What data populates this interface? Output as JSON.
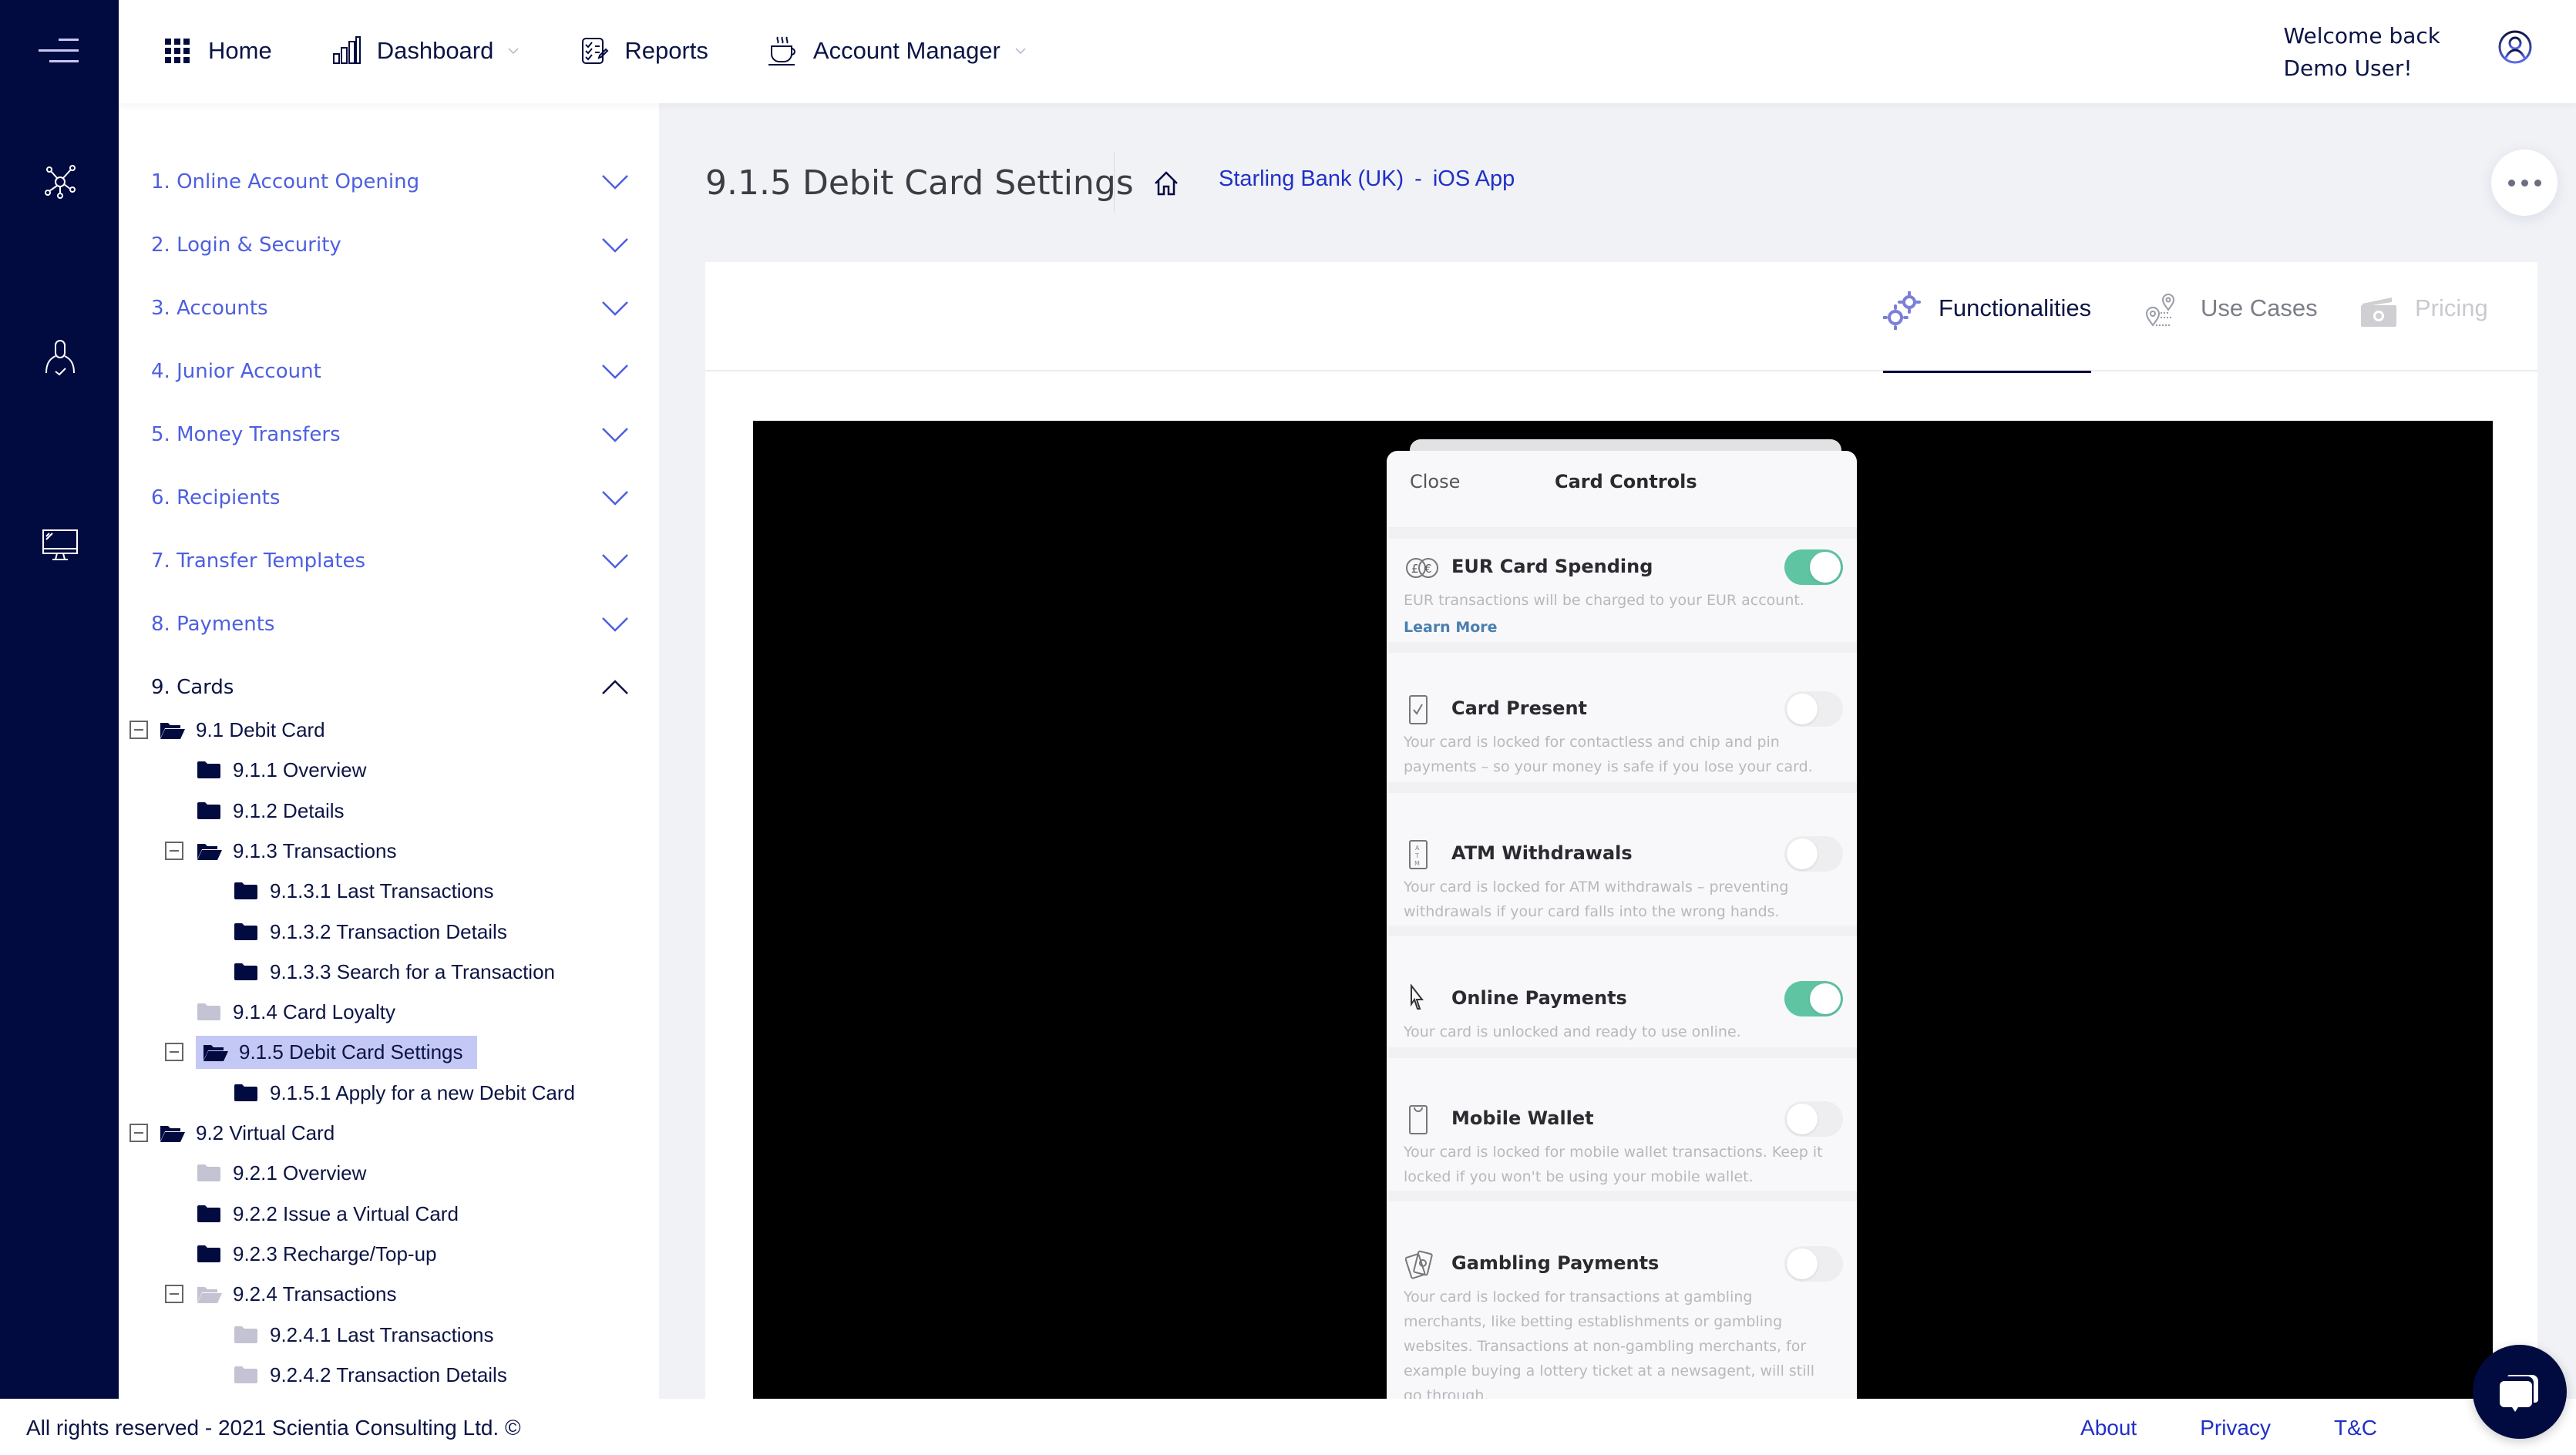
{
  "header": {
    "nav": [
      {
        "label": "Home",
        "icon": "grid-icon",
        "has_dropdown": false
      },
      {
        "label": "Dashboard",
        "icon": "bar-chart-icon",
        "has_dropdown": true
      },
      {
        "label": "Reports",
        "icon": "report-checklist-icon",
        "has_dropdown": false
      },
      {
        "label": "Account Manager",
        "icon": "coffee-cup-icon",
        "has_dropdown": true
      }
    ],
    "welcome_line1": "Welcome back",
    "welcome_line2": "Demo User!",
    "avatar_icon": "user-circle-icon"
  },
  "rail": {
    "icons": [
      "menu-icon",
      "network-icon",
      "user-check-icon",
      "monitor-icon"
    ]
  },
  "sidebar": {
    "sections": [
      {
        "label": "1. Online Account Opening",
        "expanded": false
      },
      {
        "label": "2. Login & Security",
        "expanded": false
      },
      {
        "label": "3. Accounts",
        "expanded": false
      },
      {
        "label": "4. Junior Account",
        "expanded": false
      },
      {
        "label": "5. Money Transfers",
        "expanded": false
      },
      {
        "label": "6. Recipients",
        "expanded": false
      },
      {
        "label": "7. Transfer Templates",
        "expanded": false
      },
      {
        "label": "8. Payments",
        "expanded": false
      },
      {
        "label": "9. Cards",
        "expanded": true
      }
    ],
    "tree": [
      {
        "label": "9.1 Debit Card",
        "level": 0,
        "folder": "open",
        "state": "active",
        "toggle": true
      },
      {
        "label": "9.1.1 Overview",
        "level": 1,
        "folder": "closed",
        "state": "active",
        "toggle": false
      },
      {
        "label": "9.1.2 Details",
        "level": 1,
        "folder": "closed",
        "state": "active",
        "toggle": false
      },
      {
        "label": "9.1.3 Transactions",
        "level": 1,
        "folder": "open",
        "state": "active",
        "toggle": true
      },
      {
        "label": "9.1.3.1 Last Transactions",
        "level": 2,
        "folder": "closed",
        "state": "active",
        "toggle": false
      },
      {
        "label": "9.1.3.2 Transaction Details",
        "level": 2,
        "folder": "closed",
        "state": "active",
        "toggle": false
      },
      {
        "label": "9.1.3.3 Search for a Transaction",
        "level": 2,
        "folder": "closed",
        "state": "active",
        "toggle": false
      },
      {
        "label": "9.1.4 Card Loyalty",
        "level": 1,
        "folder": "closed",
        "state": "inactive",
        "toggle": false
      },
      {
        "label": "9.1.5 Debit Card Settings",
        "level": 1,
        "folder": "open",
        "state": "active",
        "toggle": true,
        "selected": true
      },
      {
        "label": "9.1.5.1 Apply for a new Debit Card",
        "level": 2,
        "folder": "closed",
        "state": "active",
        "toggle": false
      },
      {
        "label": "9.2 Virtual Card",
        "level": 0,
        "folder": "open",
        "state": "active",
        "toggle": true
      },
      {
        "label": "9.2.1 Overview",
        "level": 1,
        "folder": "closed",
        "state": "inactive",
        "toggle": false
      },
      {
        "label": "9.2.2 Issue a Virtual Card",
        "level": 1,
        "folder": "closed",
        "state": "active",
        "toggle": false
      },
      {
        "label": "9.2.3 Recharge/Top-up",
        "level": 1,
        "folder": "closed",
        "state": "active",
        "toggle": false
      },
      {
        "label": "9.2.4 Transactions",
        "level": 1,
        "folder": "open",
        "state": "inactive",
        "toggle": true
      },
      {
        "label": "9.2.4.1 Last Transactions",
        "level": 2,
        "folder": "closed",
        "state": "inactive",
        "toggle": false
      },
      {
        "label": "9.2.4.2 Transaction Details",
        "level": 2,
        "folder": "closed",
        "state": "inactive",
        "toggle": false
      }
    ]
  },
  "main": {
    "page_title": "9.1.5 Debit Card Settings",
    "breadcrumb": {
      "bank": "Starling Bank (UK)",
      "separator": "-",
      "platform": "iOS App"
    },
    "tabs": [
      {
        "label": "Functionalities",
        "icon": "gears-icon",
        "active": true
      },
      {
        "label": "Use Cases",
        "icon": "route-pins-icon",
        "active": false
      },
      {
        "label": "Pricing",
        "icon": "banknote-icon",
        "active": false,
        "disabled": true
      }
    ]
  },
  "phone": {
    "close_label": "Close",
    "title": "Card Controls",
    "controls": [
      {
        "title": "EUR Card Spending",
        "icon": "currency-gbp-eur-icon",
        "on": true,
        "desc": "EUR transactions will be charged to your EUR account.",
        "link": "Learn More"
      },
      {
        "title": "Card Present",
        "icon": "card-check-icon",
        "on": false,
        "desc": "Your card is locked for contactless and chip and pin payments – so your money is safe if you lose your card."
      },
      {
        "title": "ATM Withdrawals",
        "icon": "atm-icon",
        "on": false,
        "desc": "Your card is locked for ATM withdrawals – preventing withdrawals if your card falls into the wrong hands."
      },
      {
        "title": "Online Payments",
        "icon": "cursor-icon",
        "on": true,
        "desc": "Your card is unlocked and ready to use online."
      },
      {
        "title": "Mobile Wallet",
        "icon": "phone-wallet-icon",
        "on": false,
        "desc": "Your card is locked for mobile wallet transactions. Keep it locked if you won't be using your mobile wallet."
      },
      {
        "title": "Gambling Payments",
        "icon": "playing-cards-icon",
        "on": false,
        "desc": "Your card is locked for transactions at gambling merchants, like betting establishments or gambling websites. Transactions at non-gambling merchants, for example buying a lottery ticket at a newsagent, will still go through."
      }
    ]
  },
  "footer": {
    "copyright": "All rights reserved - 2021 Scientia Consulting Ltd. ©",
    "links": [
      "About",
      "Privacy",
      "T&C"
    ]
  },
  "colors": {
    "rail_bg": "#020b40",
    "accent_link": "#2030c8",
    "section_link": "#4d5fe0",
    "selected_bg": "#c3c8f5",
    "toggle_on": "#5ec4a2",
    "main_bg": "#f1f2f6"
  }
}
